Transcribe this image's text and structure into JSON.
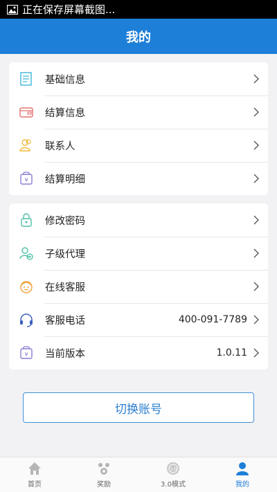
{
  "status_bar": {
    "text": "正在保存屏幕截图..."
  },
  "header": {
    "title": "我的"
  },
  "group1": [
    {
      "label": "基础信息"
    },
    {
      "label": "结算信息"
    },
    {
      "label": "联系人"
    },
    {
      "label": "结算明细"
    }
  ],
  "group2": [
    {
      "label": "修改密码"
    },
    {
      "label": "子级代理"
    },
    {
      "label": "在线客服"
    },
    {
      "label": "客服电话",
      "value": "400-091-7789"
    },
    {
      "label": "当前版本",
      "value": "1.0.11"
    }
  ],
  "switch_button": {
    "label": "切换账号"
  },
  "tabs": [
    {
      "label": "首页"
    },
    {
      "label": "奖励"
    },
    {
      "label": "3.0模式"
    },
    {
      "label": "我的"
    }
  ],
  "colors": {
    "primary": "#1e7fd8",
    "background": "#f2f2f4"
  }
}
